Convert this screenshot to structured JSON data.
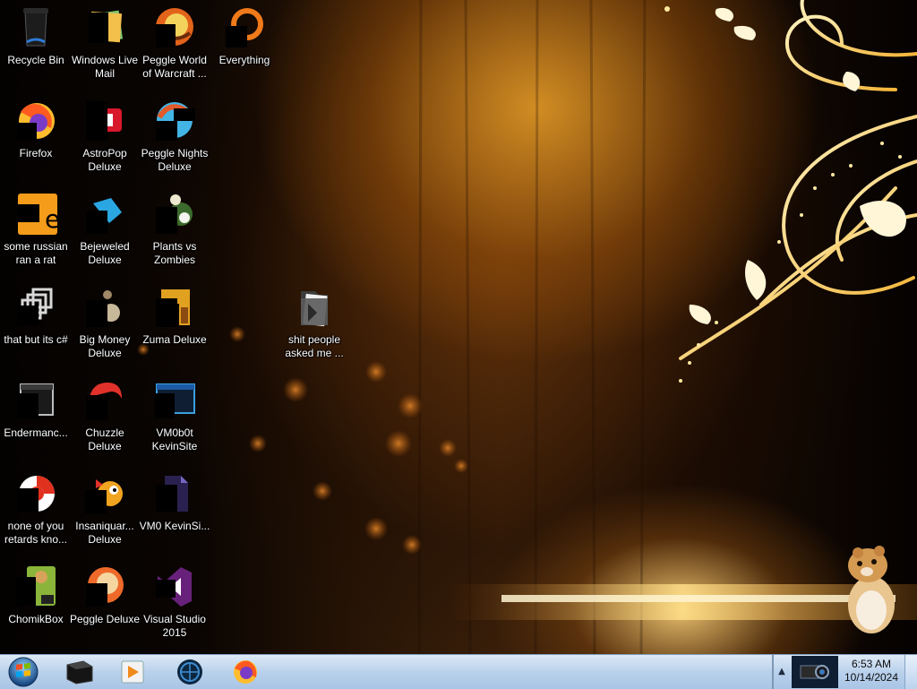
{
  "desktop": {
    "icons": [
      {
        "label": "Recycle Bin",
        "icon": "recycle-bin-icon"
      },
      {
        "label": "Windows Live Mail",
        "icon": "windows-live-mail-icon"
      },
      {
        "label": "Peggle World of Warcraft ...",
        "icon": "peggle-wow-icon"
      },
      {
        "label": "Everything",
        "icon": "everything-search-icon"
      },
      {
        "label": "Firefox",
        "icon": "firefox-icon"
      },
      {
        "label": "AstroPop Deluxe",
        "icon": "astropop-icon"
      },
      {
        "label": "Peggle Nights Deluxe",
        "icon": "peggle-nights-icon"
      },
      {
        "label": "some russian ran a rat",
        "icon": "orange-app-icon"
      },
      {
        "label": "Bejeweled Deluxe",
        "icon": "bejeweled-icon"
      },
      {
        "label": "Plants vs Zombies",
        "icon": "plants-vs-zombies-icon"
      },
      {
        "label": "that but its c#",
        "icon": "copy-windows-icon"
      },
      {
        "label": "Big Money Deluxe",
        "icon": "big-money-icon"
      },
      {
        "label": "Zuma Deluxe",
        "icon": "zuma-icon"
      },
      {
        "label": "shit people asked me ...",
        "icon": "folder-icon"
      },
      {
        "label": "Endermanc...",
        "icon": "terminal-app-icon"
      },
      {
        "label": "Chuzzle Deluxe",
        "icon": "chuzzle-icon"
      },
      {
        "label": "VM0b0t KevinSite",
        "icon": "vm-window-icon"
      },
      {
        "label": "none of you retards kno...",
        "icon": "red-circle-app-icon"
      },
      {
        "label": "Insaniquar... Deluxe",
        "icon": "insaniquarium-icon"
      },
      {
        "label": "VM0 KevinSi...",
        "icon": "document-icon"
      },
      {
        "label": "ChomikBox",
        "icon": "chomikbox-icon"
      },
      {
        "label": "Peggle Deluxe",
        "icon": "peggle-icon"
      },
      {
        "label": "Visual Studio 2015",
        "icon": "visual-studio-icon"
      }
    ]
  },
  "taskbar": {
    "start_button": "windows-start-icon",
    "pinned": [
      "black-app-icon",
      "media-player-icon",
      "globe-app-icon",
      "firefox-icon"
    ],
    "tray": {
      "show_hidden": "▲",
      "app": "projector-app-icon"
    },
    "clock": {
      "time": "6:53 AM",
      "date": "10/14/2024"
    }
  },
  "colors": {
    "taskbar_top": "#dde9f6",
    "taskbar_bottom": "#a9c4e5",
    "wallpaper_glow": "#f5c04a"
  }
}
